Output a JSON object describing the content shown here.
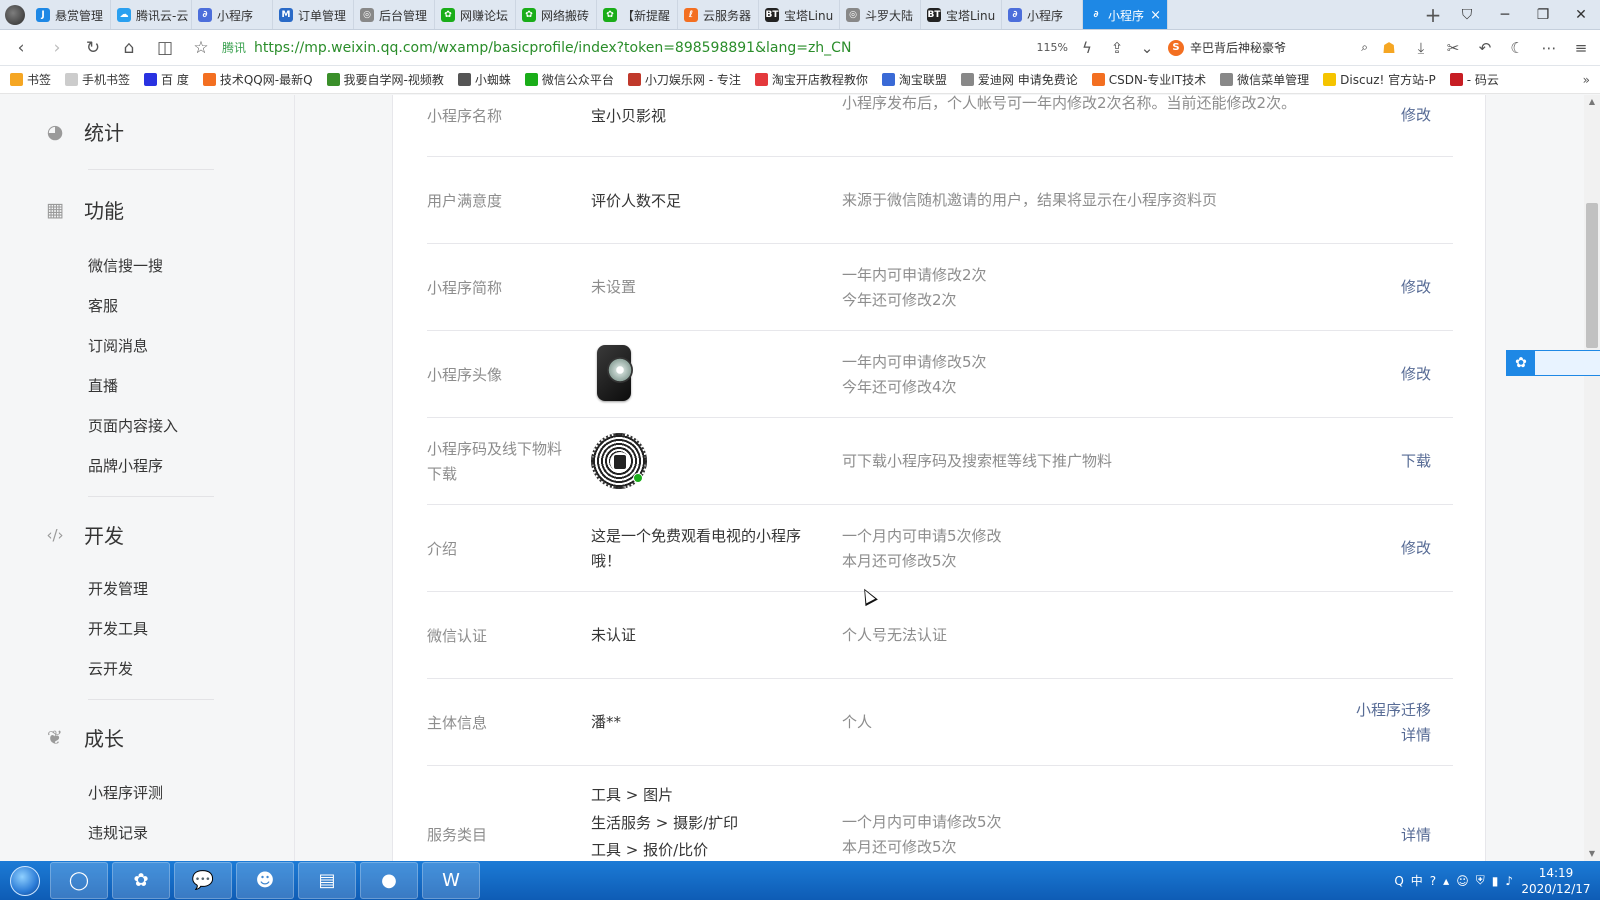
{
  "browser": {
    "tabs": [
      {
        "label": "悬赏管理",
        "icon_color": "#1e88e5",
        "icon_text": "J"
      },
      {
        "label": "腾讯云-云",
        "icon_color": "#2aa0f0",
        "icon_text": "☁"
      },
      {
        "label": "小程序",
        "icon_color": "#4c6edb",
        "icon_text": "∂"
      },
      {
        "label": "订单管理",
        "icon_color": "#2a6ac7",
        "icon_text": "M"
      },
      {
        "label": "后台管理",
        "icon_color": "#888888",
        "icon_text": "◎"
      },
      {
        "label": "网赚论坛",
        "icon_color": "#1aad19",
        "icon_text": "✿"
      },
      {
        "label": "网络搬砖",
        "icon_color": "#1aad19",
        "icon_text": "✿"
      },
      {
        "label": "【新提醒",
        "icon_color": "#1aad19",
        "icon_text": "✿"
      },
      {
        "label": "云服务器",
        "icon_color": "#f36f21",
        "icon_text": "ℓ"
      },
      {
        "label": "宝塔Linu",
        "icon_color": "#222222",
        "icon_text": "BT"
      },
      {
        "label": "斗罗大陆",
        "icon_color": "#888888",
        "icon_text": "◎"
      },
      {
        "label": "宝塔Linu",
        "icon_color": "#222222",
        "icon_text": "BT"
      },
      {
        "label": "小程序",
        "icon_color": "#4c6edb",
        "icon_text": "∂"
      },
      {
        "label": "小程序",
        "icon_color": "#ffffff",
        "icon_text": "∂",
        "active": true
      }
    ],
    "tab_close": "×",
    "new_tab": "+",
    "url_secure_label": "腾讯",
    "url": "https://mp.weixin.qq.com/wxamp/basicprofile/index?token=898598891&lang=zh_CN",
    "zoom": "115%",
    "search_placeholder": "辛巴背后神秘豪爷",
    "bookmarks": [
      {
        "label": "书签",
        "color": "#f5a623"
      },
      {
        "label": "手机书签",
        "color": "#cccccc"
      },
      {
        "label": "百 度",
        "color": "#2932e1"
      },
      {
        "label": "技术QQ网-最新Q",
        "color": "#f36f21"
      },
      {
        "label": "我要自学网-视频教",
        "color": "#3a8f2a"
      },
      {
        "label": "小蜘蛛",
        "color": "#555555"
      },
      {
        "label": "微信公众平台",
        "color": "#1aad19"
      },
      {
        "label": "小刀娱乐网 - 专注",
        "color": "#c0392b"
      },
      {
        "label": "淘宝开店教程教你",
        "color": "#e4393c"
      },
      {
        "label": "淘宝联盟",
        "color": "#3a6ad6"
      },
      {
        "label": "爱迪网 申请免费论",
        "color": "#888888"
      },
      {
        "label": "CSDN-专业IT技术",
        "color": "#f36f21"
      },
      {
        "label": "微信菜单管理",
        "color": "#888888"
      },
      {
        "label": "Discuz! 官方站-P",
        "color": "#f5c400"
      },
      {
        "label": "- 码云",
        "color": "#c71d23"
      }
    ],
    "bookmarks_more": "»"
  },
  "sidebar": {
    "groups": [
      {
        "label": "统计",
        "icon": "pie-chart-icon",
        "glyph": "◕"
      },
      {
        "label": "功能",
        "icon": "grid-icon",
        "glyph": "▦"
      },
      {
        "label": "开发",
        "icon": "code-icon",
        "glyph": "‹/›"
      },
      {
        "label": "成长",
        "icon": "sprout-icon",
        "glyph": "❦"
      }
    ],
    "function_items": [
      "微信搜一搜",
      "客服",
      "订阅消息",
      "直播",
      "页面内容接入",
      "品牌小程序"
    ],
    "dev_items": [
      "开发管理",
      "开发工具",
      "云开发"
    ],
    "growth_items": [
      "小程序评测",
      "违规记录"
    ]
  },
  "profile": {
    "rows": [
      {
        "label": "小程序名称",
        "value": "宝小贝影视",
        "desc": "小程序发布后，个人帐号可一年内修改2次名称。当前还能修改2次。",
        "action": "修改"
      },
      {
        "label": "用户满意度",
        "value": "评价人数不足",
        "desc": "来源于微信随机邀请的用户，结果将显示在小程序资料页",
        "action": ""
      },
      {
        "label": "小程序简称",
        "value": "未设置",
        "desc_line1": "一年内可申请修改2次",
        "desc_line2": "今年还可修改2次",
        "action": "修改"
      },
      {
        "label": "小程序头像",
        "value": "",
        "desc_line1": "一年内可申请修改5次",
        "desc_line2": "今年还可修改4次",
        "action": "修改"
      },
      {
        "label": "小程序码及线下物料下载",
        "value": "",
        "desc": "可下载小程序码及搜索框等线下推广物料",
        "action": "下载"
      },
      {
        "label": "介绍",
        "value": "这是一个免费观看电视的小程序哦！",
        "desc_line1": "一个月内可申请5次修改",
        "desc_line2": "本月还可修改5次",
        "action": "修改"
      },
      {
        "label": "微信认证",
        "value": "未认证",
        "desc": "个人号无法认证",
        "action": ""
      },
      {
        "label": "主体信息",
        "value": "潘**",
        "desc": "个人",
        "action_line1": "小程序迁移",
        "action_line2": "详情"
      },
      {
        "label": "服务类目",
        "value_lines": [
          "工具 > 图片",
          "生活服务 > 摄影/扩印",
          "工具 > 报价/比价"
        ],
        "desc_line1": "一个月内可申请修改5次",
        "desc_line2": "本月还可修改5次",
        "action": "详情"
      }
    ]
  },
  "taskbar": {
    "apps": [
      {
        "name": "browser-app",
        "glyph": "◯"
      },
      {
        "name": "baidu-netdisk-app",
        "glyph": "✿"
      },
      {
        "name": "wechat-app",
        "glyph": "💬"
      },
      {
        "name": "game-app",
        "glyph": "☻"
      },
      {
        "name": "file-explorer-app",
        "glyph": "▤"
      },
      {
        "name": "recorder-app",
        "glyph": "●"
      },
      {
        "name": "wps-app",
        "glyph": "W"
      }
    ],
    "tray_ime": "中",
    "clock_time": "14:19",
    "clock_date": "2020/12/17"
  }
}
